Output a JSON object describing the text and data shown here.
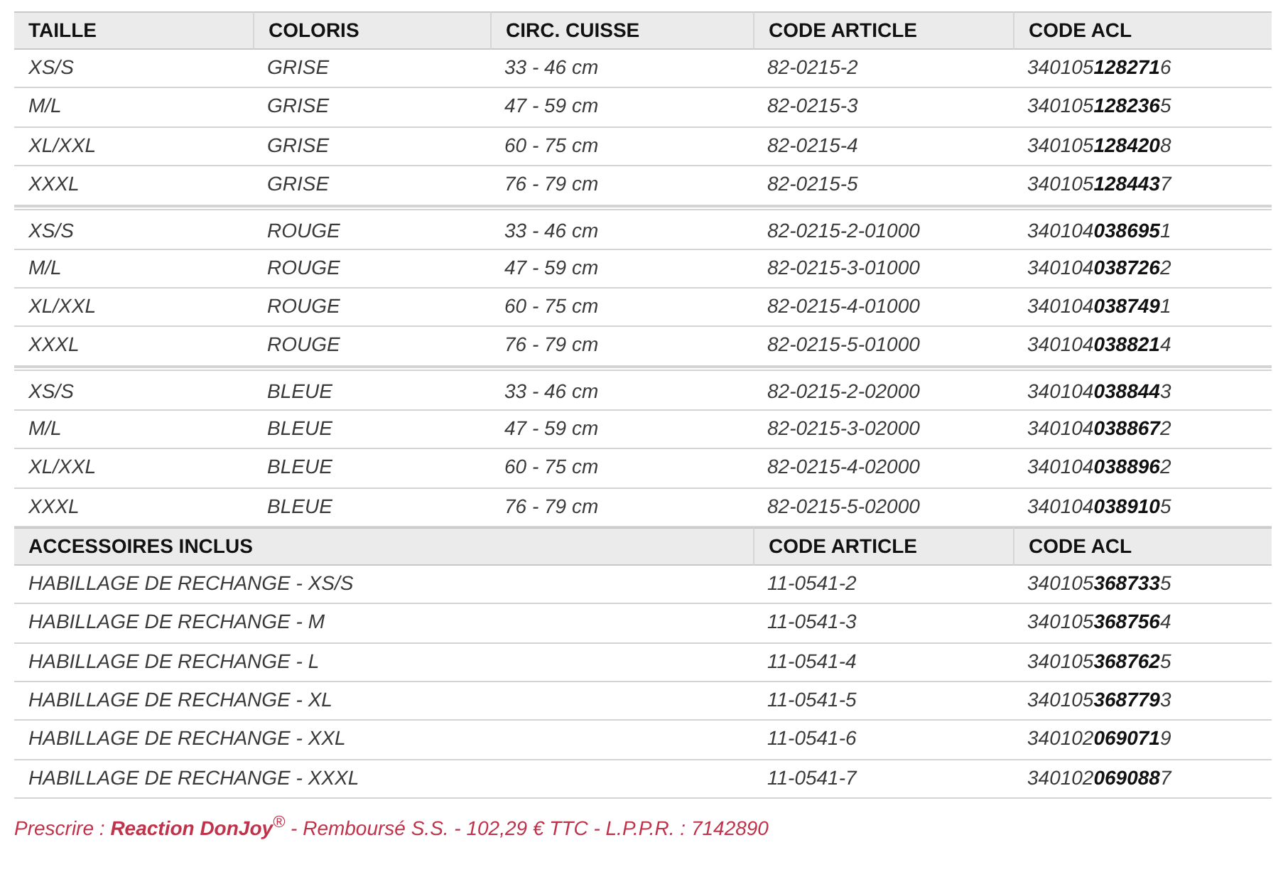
{
  "size_table": {
    "columns": [
      "TAILLE",
      "COLORIS",
      "CIRC. CUISSE",
      "CODE ARTICLE",
      "CODE ACL"
    ],
    "groups": [
      {
        "rows": [
          [
            "XS/S",
            "GRISE",
            "33 - 46 cm",
            "82-0215-2",
            "340105**128271**6"
          ],
          [
            "M/L",
            "GRISE",
            "47 - 59 cm",
            "82-0215-3",
            "340105**128236**5"
          ],
          [
            "XL/XXL",
            "GRISE",
            "60 - 75 cm",
            "82-0215-4",
            "340105**128420**8"
          ],
          [
            "XXXL",
            "GRISE",
            "76 - 79 cm",
            "82-0215-5",
            "340105**128443**7"
          ]
        ]
      },
      {
        "rows": [
          [
            "XS/S",
            "ROUGE",
            "33 - 46 cm",
            "82-0215-2-01000",
            "340104**038695**1"
          ],
          [
            "M/L",
            "ROUGE",
            "47 - 59 cm",
            "82-0215-3-01000",
            "340104**038726**2"
          ],
          [
            "XL/XXL",
            "ROUGE",
            "60 - 75 cm",
            "82-0215-4-01000",
            "340104**038749**1"
          ],
          [
            "XXXL",
            "ROUGE",
            "76 - 79 cm",
            "82-0215-5-01000",
            "340104**038821**4"
          ]
        ]
      },
      {
        "rows": [
          [
            "XS/S",
            "BLEUE",
            "33 - 46 cm",
            "82-0215-2-02000",
            "340104**038844**3"
          ],
          [
            "M/L",
            "BLEUE",
            "47 - 59 cm",
            "82-0215-3-02000",
            "340104**038867**2"
          ],
          [
            "XL/XXL",
            "BLEUE",
            "60 - 75 cm",
            "82-0215-4-02000",
            "340104**038896**2"
          ],
          [
            "XXXL",
            "BLEUE",
            "76 - 79 cm",
            "82-0215-5-02000",
            "340104**038910**5"
          ]
        ]
      }
    ]
  },
  "accessories_table": {
    "columns": [
      "ACCESSOIRES INCLUS",
      "CODE ARTICLE",
      "CODE ACL"
    ],
    "rows": [
      [
        "HABILLAGE DE RECHANGE - XS/S",
        "11-0541-2",
        "340105**368733**5"
      ],
      [
        "HABILLAGE DE RECHANGE - M",
        "11-0541-3",
        "340105**368756**4"
      ],
      [
        "HABILLAGE DE RECHANGE - L",
        "11-0541-4",
        "340105**368762**5"
      ],
      [
        "HABILLAGE DE RECHANGE - XL",
        "11-0541-5",
        "340105**368779**3"
      ],
      [
        "HABILLAGE DE RECHANGE - XXL",
        "11-0541-6",
        "340102**069071**9"
      ],
      [
        "HABILLAGE DE RECHANGE - XXXL",
        "11-0541-7",
        "340102**069088**7"
      ]
    ]
  },
  "footer": "Prescrire : **Reaction DonJoy**$^{®}$ - Remboursé S.S. - 102,29 € TTC - L.P.P.R. : 7142890"
}
